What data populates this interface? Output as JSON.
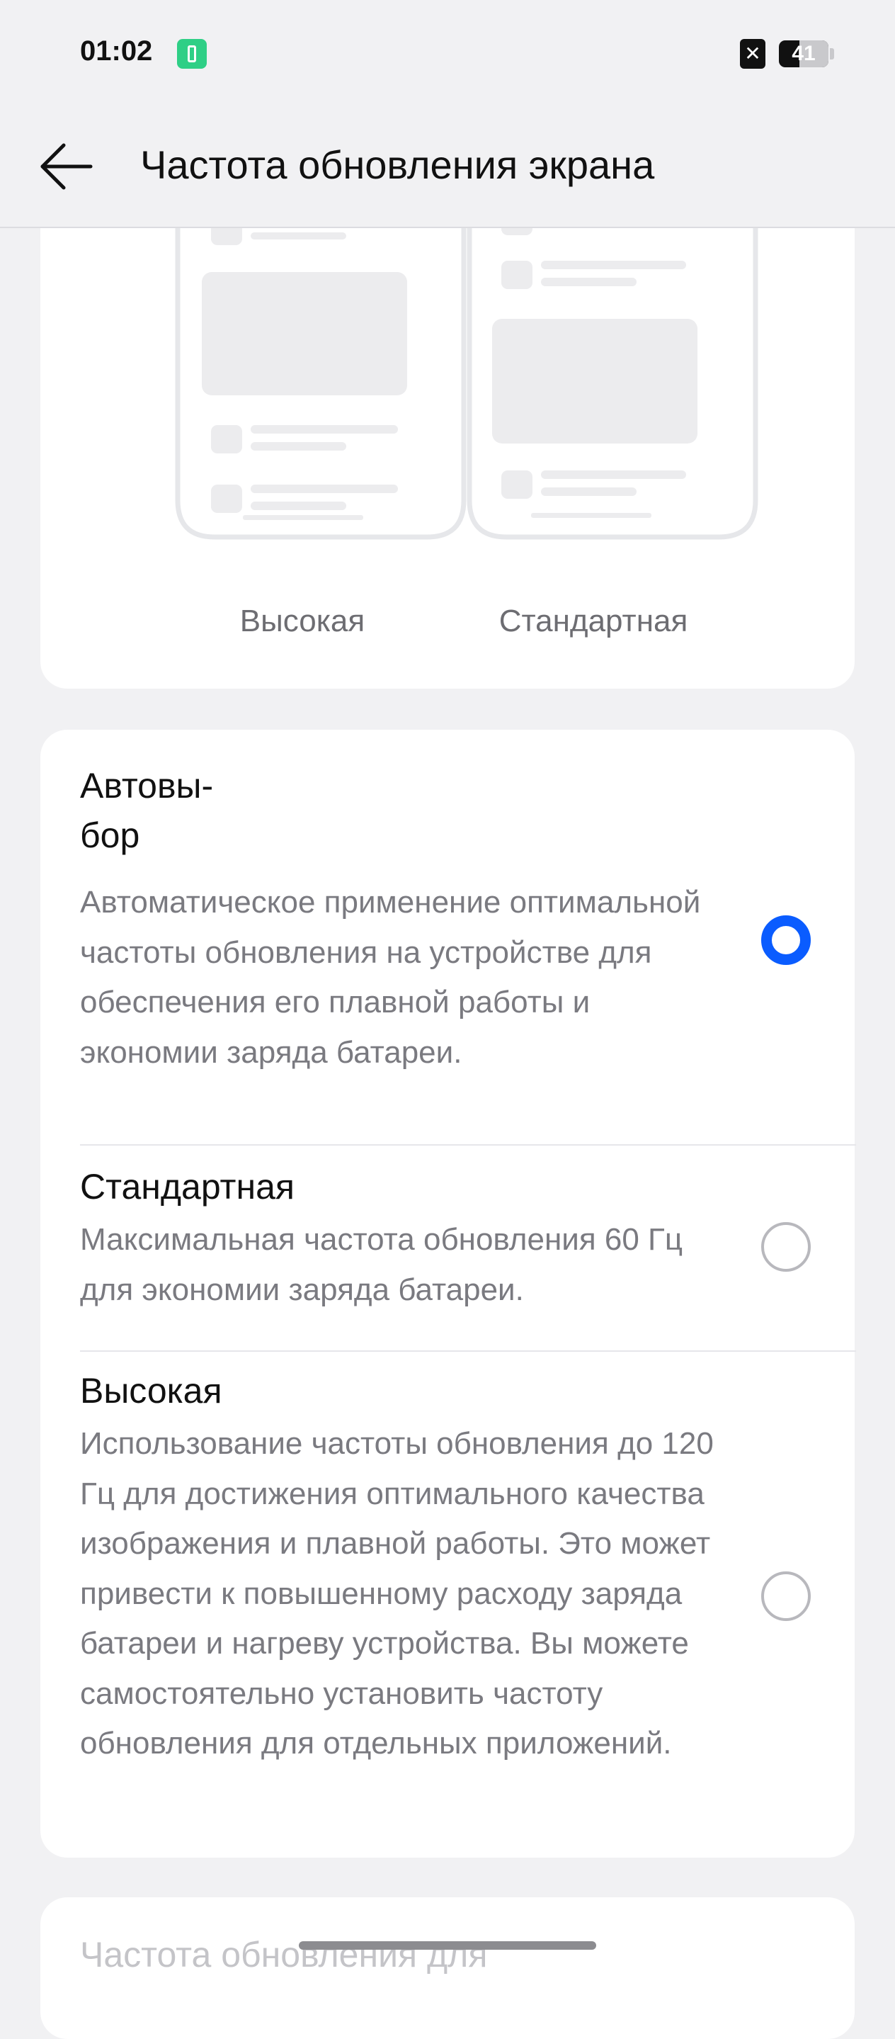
{
  "status_bar": {
    "time": "01:02",
    "battery_level": "41",
    "battery_fraction": 0.41,
    "sim_icon_glyph": "✕",
    "charge_icon": "battery-charging-icon",
    "sim_icon": "no-sim-icon"
  },
  "header": {
    "back_icon": "arrow-left-icon",
    "title": "Частота обновления экрана"
  },
  "preview": {
    "left_label": "Высокая",
    "right_label": "Стандартная"
  },
  "options": [
    {
      "title": "Автовы-\nбор",
      "description": "Автоматическое применение оптимальной частоты обновления на устройстве для обеспечения его плавной работы и экономии заряда батареи.",
      "selected": true
    },
    {
      "title": "Стандартная",
      "description": "Максимальная частота обновления 60 Гц для экономии заряда батареи.",
      "selected": false
    },
    {
      "title": "Высокая",
      "description": "Использование частоты обновления до 120 Гц для достижения оптимального качества изображения и плавной работы. Это может привести к повышенному расходу заряда батареи и нагреву устройства. Вы можете самостоятельно установить частоту обновления для отдельных приложений.",
      "selected": false
    }
  ],
  "bottom_section": {
    "title": "Частота обновления для"
  },
  "colors": {
    "accent": "#0a5cff",
    "background": "#f1f1f3",
    "card": "#ffffff",
    "charge_green": "#2fcf86"
  }
}
